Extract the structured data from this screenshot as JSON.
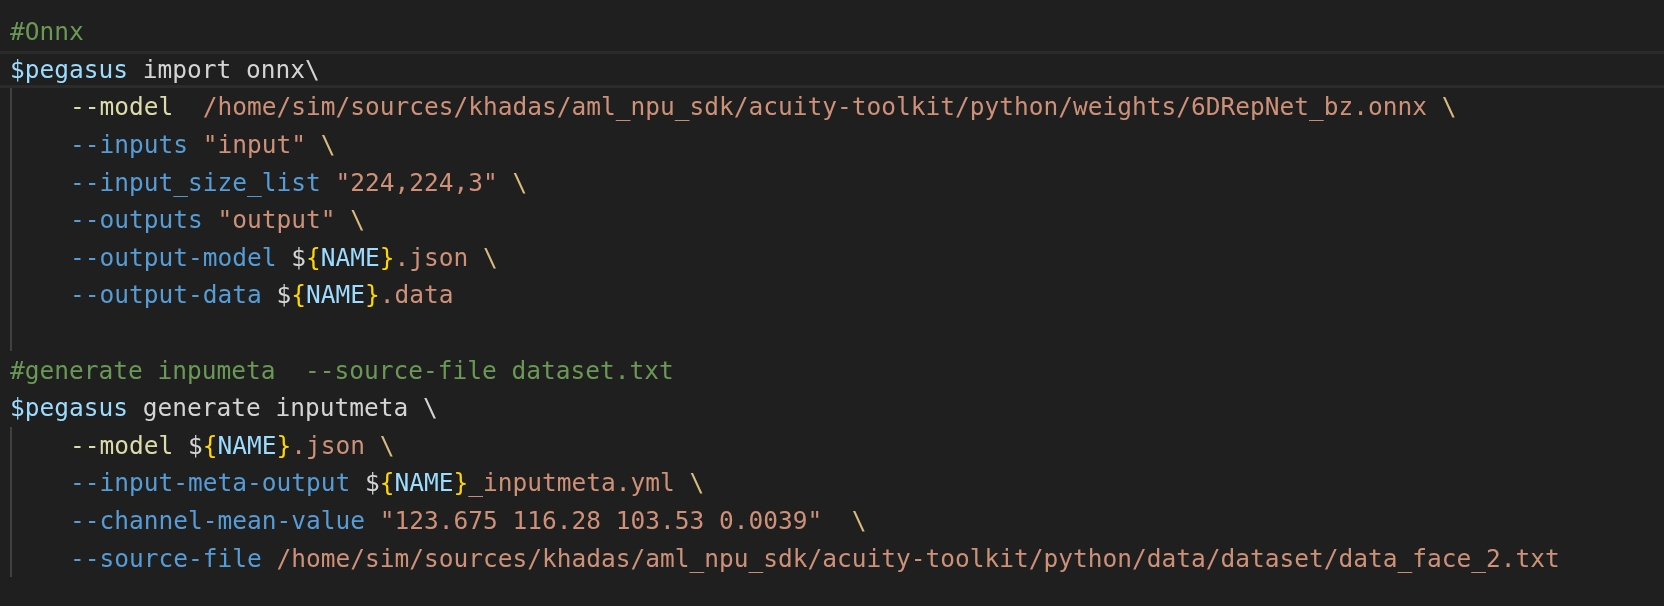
{
  "editor": {
    "lines": [
      {
        "indented": false,
        "current": false,
        "tokens": [
          {
            "kind": "comment",
            "text": "#Onnx"
          }
        ]
      },
      {
        "indented": false,
        "current": true,
        "tokens": [
          {
            "kind": "variable",
            "text": "$pegasus"
          },
          {
            "kind": "plain",
            "text": " import onnx\\"
          }
        ]
      },
      {
        "indented": true,
        "current": false,
        "tokens": [
          {
            "kind": "function",
            "text": "--model"
          },
          {
            "kind": "string",
            "text": "  /home/sim/sources/khadas/aml_npu_sdk/acuity-toolkit/python/weights/6DRepNet_bz.onnx"
          },
          {
            "kind": "escape",
            "text": " \\"
          }
        ]
      },
      {
        "indented": true,
        "current": false,
        "tokens": [
          {
            "kind": "flag",
            "text": "--inputs"
          },
          {
            "kind": "string",
            "text": " \"input\""
          },
          {
            "kind": "escape",
            "text": " \\"
          }
        ]
      },
      {
        "indented": true,
        "current": false,
        "tokens": [
          {
            "kind": "flag",
            "text": "--input_size_list"
          },
          {
            "kind": "string",
            "text": " \"224,224,3\""
          },
          {
            "kind": "escape",
            "text": " \\"
          }
        ]
      },
      {
        "indented": true,
        "current": false,
        "tokens": [
          {
            "kind": "flag",
            "text": "--outputs"
          },
          {
            "kind": "string",
            "text": " \"output\""
          },
          {
            "kind": "escape",
            "text": " \\"
          }
        ]
      },
      {
        "indented": true,
        "current": false,
        "tokens": [
          {
            "kind": "flag",
            "text": "--output-model"
          },
          {
            "kind": "plain",
            "text": " $"
          },
          {
            "kind": "brace",
            "text": "{"
          },
          {
            "kind": "variable",
            "text": "NAME"
          },
          {
            "kind": "brace",
            "text": "}"
          },
          {
            "kind": "string",
            "text": ".json"
          },
          {
            "kind": "escape",
            "text": " \\"
          }
        ]
      },
      {
        "indented": true,
        "current": false,
        "tokens": [
          {
            "kind": "flag",
            "text": "--output-data"
          },
          {
            "kind": "plain",
            "text": " $"
          },
          {
            "kind": "brace",
            "text": "{"
          },
          {
            "kind": "variable",
            "text": "NAME"
          },
          {
            "kind": "brace",
            "text": "}"
          },
          {
            "kind": "string",
            "text": ".data"
          }
        ]
      },
      {
        "indented": true,
        "current": false
      },
      {
        "indented": false,
        "current": false,
        "tokens": [
          {
            "kind": "comment",
            "text": "#generate inpumeta  --source-file dataset.txt"
          }
        ]
      },
      {
        "indented": false,
        "current": false,
        "tokens": [
          {
            "kind": "variable",
            "text": "$pegasus"
          },
          {
            "kind": "plain",
            "text": " generate inputmeta \\"
          }
        ]
      },
      {
        "indented": true,
        "current": false,
        "tokens": [
          {
            "kind": "function",
            "text": "--model"
          },
          {
            "kind": "plain",
            "text": " $"
          },
          {
            "kind": "brace",
            "text": "{"
          },
          {
            "kind": "variable",
            "text": "NAME"
          },
          {
            "kind": "brace",
            "text": "}"
          },
          {
            "kind": "string",
            "text": ".json"
          },
          {
            "kind": "escape",
            "text": " \\"
          }
        ]
      },
      {
        "indented": true,
        "current": false,
        "tokens": [
          {
            "kind": "flag",
            "text": "--input-meta-output"
          },
          {
            "kind": "plain",
            "text": " $"
          },
          {
            "kind": "brace",
            "text": "{"
          },
          {
            "kind": "variable",
            "text": "NAME"
          },
          {
            "kind": "brace",
            "text": "}"
          },
          {
            "kind": "string",
            "text": "_inputmeta.yml"
          },
          {
            "kind": "escape",
            "text": " \\"
          }
        ]
      },
      {
        "indented": true,
        "current": false,
        "tokens": [
          {
            "kind": "flag",
            "text": "--channel-mean-value"
          },
          {
            "kind": "string",
            "text": " \"123.675 116.28 103.53 0.0039\""
          },
          {
            "kind": "escape",
            "text": "  \\"
          }
        ]
      },
      {
        "indented": true,
        "current": false,
        "tokens": [
          {
            "kind": "flag",
            "text": "--source-file"
          },
          {
            "kind": "string",
            "text": " /home/sim/sources/khadas/aml_npu_sdk/acuity-toolkit/python/data/dataset/data_face_2.txt"
          }
        ]
      }
    ]
  }
}
